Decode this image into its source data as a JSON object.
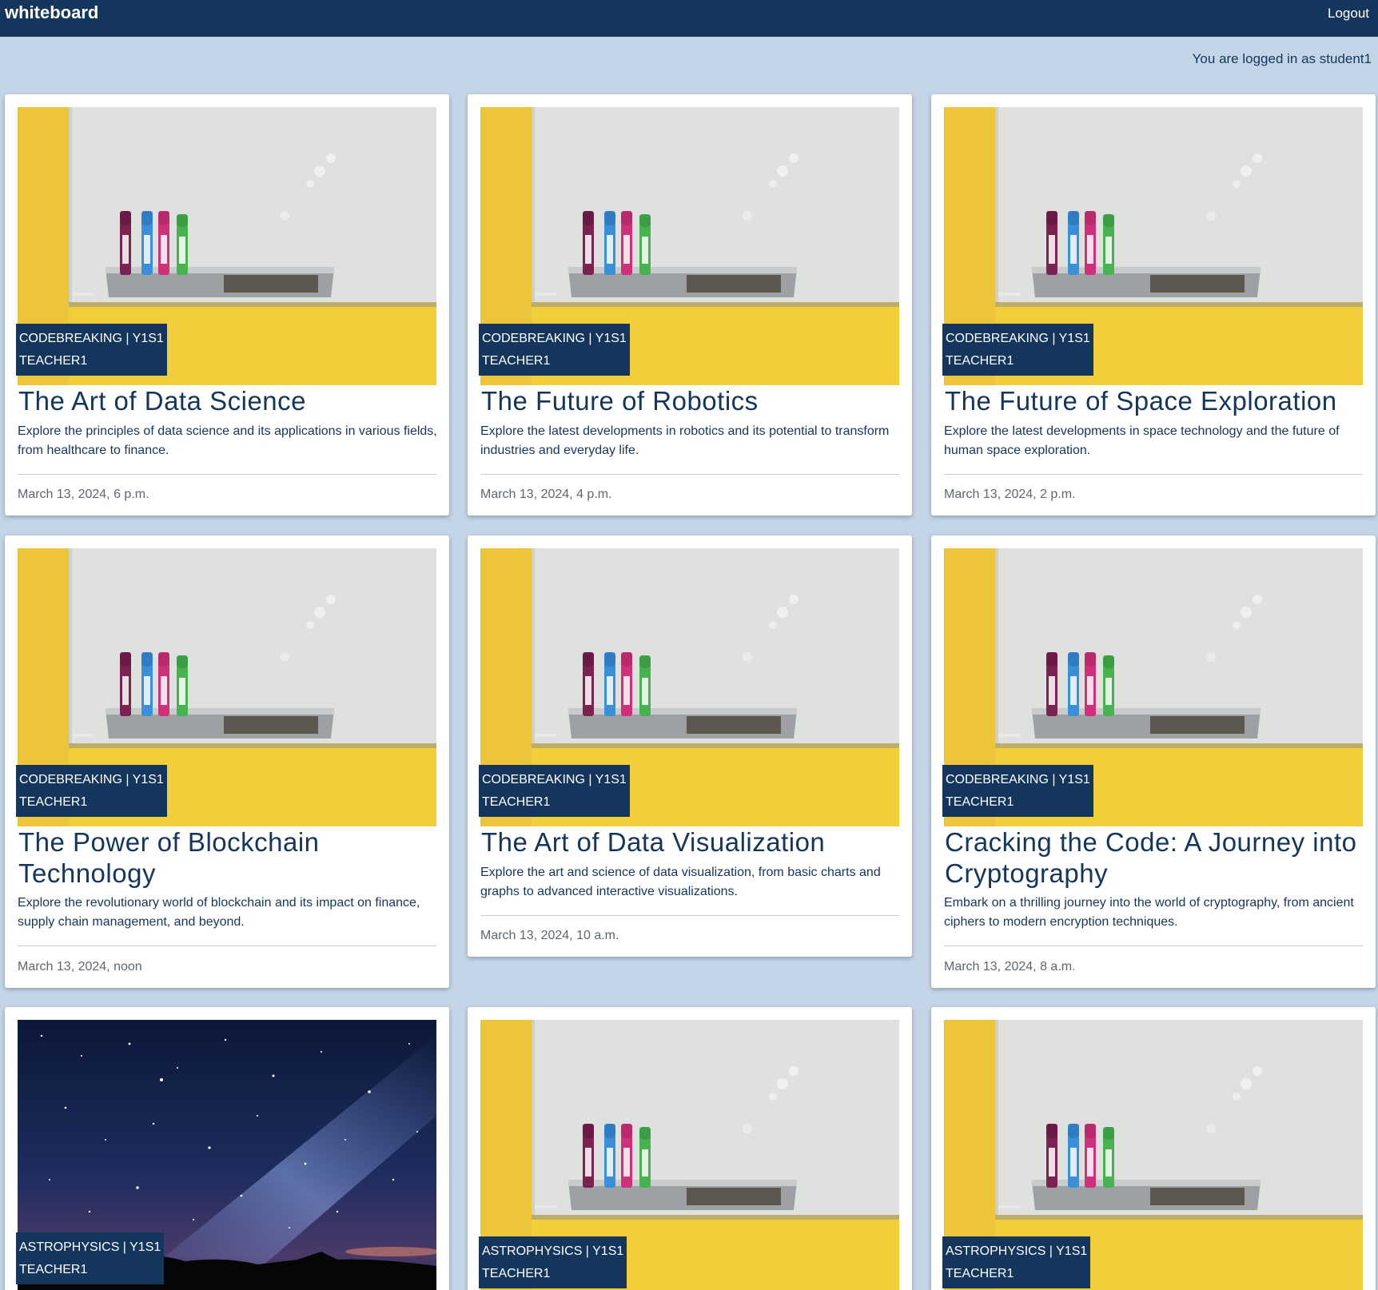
{
  "navbar": {
    "brand": "whiteboard",
    "logout_label": "Logout"
  },
  "login_status": "You are logged in as student1",
  "colors": {
    "navbar": "#14365d",
    "page_background": "#c4d5e7",
    "card": "#ffffff",
    "badge": "#14365d"
  },
  "cards": [
    {
      "image": "whiteboard-markers-image",
      "badge_line1": "CODEBREAKING | Y1S1",
      "badge_line2": "TEACHER1",
      "title": "The Art of Data Science",
      "description": "Explore the principles of data science and its applications in various fields, from healthcare to finance.",
      "date": "March 13, 2024, 6 p.m."
    },
    {
      "image": "whiteboard-markers-image",
      "badge_line1": "CODEBREAKING | Y1S1",
      "badge_line2": "TEACHER1",
      "title": "The Future of Robotics",
      "description": "Explore the latest developments in robotics and its potential to transform industries and everyday life.",
      "date": "March 13, 2024, 4 p.m."
    },
    {
      "image": "whiteboard-markers-image",
      "badge_line1": "CODEBREAKING | Y1S1",
      "badge_line2": "TEACHER1",
      "title": "The Future of Space Exploration",
      "description": "Explore the latest developments in space technology and the future of human space exploration.",
      "date": "March 13, 2024, 2 p.m."
    },
    {
      "image": "whiteboard-markers-image",
      "badge_line1": "CODEBREAKING | Y1S1",
      "badge_line2": "TEACHER1",
      "title": "The Power of Blockchain Technology",
      "description": "Explore the revolutionary world of blockchain and its impact on finance, supply chain management, and beyond.",
      "date": "March 13, 2024, noon"
    },
    {
      "image": "whiteboard-markers-image",
      "badge_line1": "CODEBREAKING | Y1S1",
      "badge_line2": "TEACHER1",
      "title": "The Art of Data Visualization",
      "description": "Explore the art and science of data visualization, from basic charts and graphs to advanced interactive visualizations.",
      "date": "March 13, 2024, 10 a.m."
    },
    {
      "image": "whiteboard-markers-image",
      "badge_line1": "CODEBREAKING | Y1S1",
      "badge_line2": "TEACHER1",
      "title": "Cracking the Code: A Journey into Cryptography",
      "description": "Embark on a thrilling journey into the world of cryptography, from ancient ciphers to modern encryption techniques.",
      "date": "March 13, 2024, 8 a.m."
    },
    {
      "image": "night-sky-image",
      "badge_line1": "ASTROPHYSICS | Y1S1",
      "badge_line2": "TEACHER1"
    },
    {
      "image": "whiteboard-markers-image",
      "badge_line1": "ASTROPHYSICS | Y1S1",
      "badge_line2": "TEACHER1"
    },
    {
      "image": "whiteboard-markers-image",
      "badge_line1": "ASTROPHYSICS | Y1S1",
      "badge_line2": "TEACHER1"
    }
  ]
}
